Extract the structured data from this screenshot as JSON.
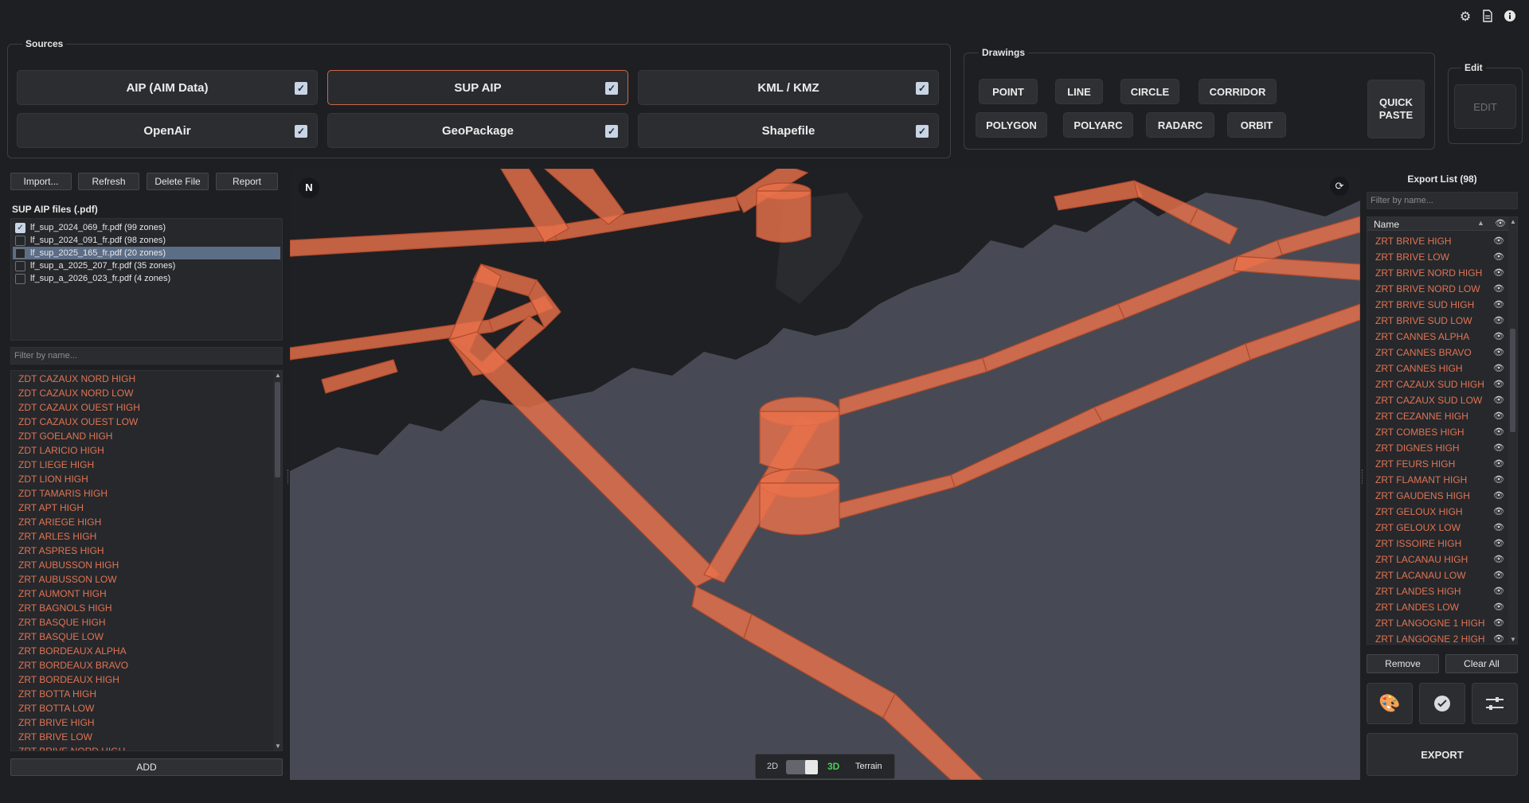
{
  "top_icons": [
    "gear-icon",
    "document-icon",
    "info-icon"
  ],
  "sources": {
    "title": "Sources",
    "buttons": [
      {
        "label": "AIP (AIM Data)",
        "checked": true
      },
      {
        "label": "SUP AIP",
        "checked": true
      },
      {
        "label": "KML / KMZ",
        "checked": true
      },
      {
        "label": "OpenAir",
        "checked": true
      },
      {
        "label": "GeoPackage",
        "checked": true
      },
      {
        "label": "Shapefile",
        "checked": true
      }
    ]
  },
  "drawings": {
    "title": "Drawings",
    "buttons": [
      "POINT",
      "LINE",
      "CIRCLE",
      "CORRIDOR",
      "POLYGON",
      "POLYARC",
      "RADARC",
      "ORBIT"
    ],
    "quick_paste_line1": "QUICK",
    "quick_paste_line2": "PASTE"
  },
  "edit": {
    "title": "Edit",
    "button": "EDIT"
  },
  "file_actions": {
    "import": "Import...",
    "refresh": "Refresh",
    "delete": "Delete File",
    "report": "Report"
  },
  "files": {
    "title": "SUP AIP files (.pdf)",
    "items": [
      {
        "label": "lf_sup_2024_069_fr.pdf  (99 zones)",
        "checked": true,
        "selected": false
      },
      {
        "label": "lf_sup_2024_091_fr.pdf  (98 zones)",
        "checked": false,
        "selected": false
      },
      {
        "label": "lf_sup_2025_165_fr.pdf  (20 zones)",
        "checked": false,
        "selected": true
      },
      {
        "label": "lf_sup_a_2025_207_fr.pdf  (35 zones)",
        "checked": false,
        "selected": false
      },
      {
        "label": "lf_sup_a_2026_023_fr.pdf  (4 zones)",
        "checked": false,
        "selected": false
      }
    ]
  },
  "zone_filter_placeholder": "Filter by name...",
  "zones": [
    "ZDT CAZAUX NORD HIGH",
    "ZDT CAZAUX NORD LOW",
    "ZDT CAZAUX OUEST HIGH",
    "ZDT CAZAUX OUEST LOW",
    "ZDT GOELAND HIGH",
    "ZDT LARICIO HIGH",
    "ZDT LIEGE HIGH",
    "ZDT LION HIGH",
    "ZDT TAMARIS HIGH",
    "ZRT APT HIGH",
    "ZRT ARIEGE HIGH",
    "ZRT ARLES HIGH",
    "ZRT ASPRES HIGH",
    "ZRT AUBUSSON HIGH",
    "ZRT AUBUSSON LOW",
    "ZRT AUMONT HIGH",
    "ZRT BAGNOLS HIGH",
    "ZRT BASQUE HIGH",
    "ZRT BASQUE LOW",
    "ZRT BORDEAUX ALPHA",
    "ZRT BORDEAUX BRAVO",
    "ZRT BORDEAUX HIGH",
    "ZRT BOTTA HIGH",
    "ZRT BOTTA LOW",
    "ZRT BRIVE HIGH",
    "ZRT BRIVE LOW",
    "ZRT BRIVE NORD HIGH"
  ],
  "add_button": "ADD",
  "map": {
    "north_label": "N",
    "mode_2d": "2D",
    "mode_3d": "3D",
    "terrain": "Terrain",
    "mode_is_3d": true
  },
  "export": {
    "title": "Export List (98)",
    "filter_placeholder": "Filter by name...",
    "column_name": "Name",
    "items": [
      "ZRT BRIVE HIGH",
      "ZRT BRIVE LOW",
      "ZRT BRIVE NORD HIGH",
      "ZRT BRIVE NORD LOW",
      "ZRT BRIVE SUD HIGH",
      "ZRT BRIVE SUD LOW",
      "ZRT CANNES ALPHA",
      "ZRT CANNES BRAVO",
      "ZRT CANNES HIGH",
      "ZRT CAZAUX SUD HIGH",
      "ZRT CAZAUX SUD LOW",
      "ZRT CEZANNE HIGH",
      "ZRT COMBES HIGH",
      "ZRT DIGNES HIGH",
      "ZRT FEURS HIGH",
      "ZRT FLAMANT HIGH",
      "ZRT GAUDENS HIGH",
      "ZRT GELOUX HIGH",
      "ZRT GELOUX LOW",
      "ZRT ISSOIRE HIGH",
      "ZRT LACANAU HIGH",
      "ZRT LACANAU LOW",
      "ZRT LANDES HIGH",
      "ZRT LANDES LOW",
      "ZRT LANGOGNE 1 HIGH",
      "ZRT LANGOGNE 2 HIGH"
    ],
    "remove": "Remove",
    "clear_all": "Clear All",
    "export_button": "EXPORT",
    "tool_icons": [
      "palette-icon",
      "check-badge-icon",
      "sliders-icon"
    ]
  },
  "colors": {
    "accent": "#e07453",
    "zone_fill": "#e8714b",
    "map_bg": "#474a54",
    "shadow": "#1f2023"
  }
}
